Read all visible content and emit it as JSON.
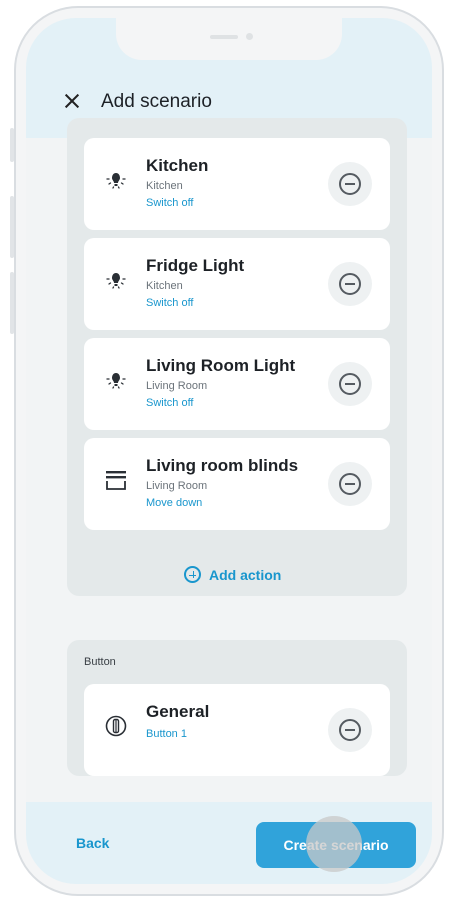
{
  "header": {
    "title": "Add scenario",
    "close_icon": "close-icon"
  },
  "actions": [
    {
      "name": "Kitchen",
      "room": "Kitchen",
      "action": "Switch off",
      "icon": "light-bulb-icon"
    },
    {
      "name": "Fridge Light",
      "room": "Kitchen",
      "action": "Switch off",
      "icon": "light-bulb-icon"
    },
    {
      "name": "Living Room Light",
      "room": "Living Room",
      "action": "Switch off",
      "icon": "light-bulb-icon"
    },
    {
      "name": "Living room blinds",
      "room": "Living Room",
      "action": "Move down",
      "icon": "blinds-icon"
    }
  ],
  "add_action_label": "Add action",
  "button_section": {
    "label": "Button",
    "item": {
      "name": "General",
      "sub": "Button 1",
      "icon": "button-device-icon"
    }
  },
  "footer": {
    "back_label": "Back",
    "create_label": "Create scenario"
  },
  "colors": {
    "accent": "#1996cd",
    "primary_button": "#30a3da",
    "header_bg": "#e3f1f7",
    "panel_bg": "#e4e9ea"
  }
}
